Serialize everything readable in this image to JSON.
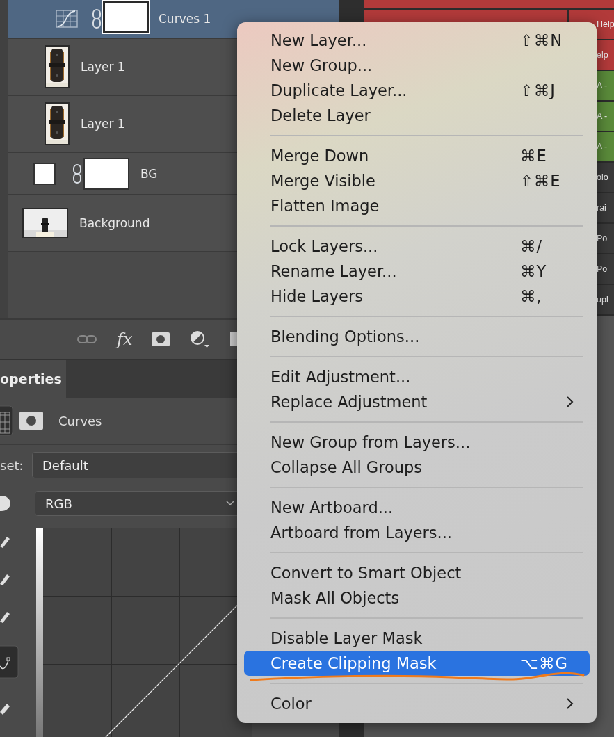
{
  "layers": [
    {
      "name": "Curves 1",
      "kind": "adjustment",
      "selected": true
    },
    {
      "name": "Layer 1",
      "selected": false
    },
    {
      "name": "Layer 1",
      "selected": false
    },
    {
      "name": "BG",
      "kind": "fill",
      "selected": false
    },
    {
      "name": "Background",
      "kind": "background",
      "selected": false
    }
  ],
  "layer_toolbar": {
    "fx": "fx"
  },
  "properties": {
    "tab": "operties",
    "type": "Curves",
    "preset_label": "set:",
    "preset": "Default",
    "channel": "RGB"
  },
  "right_table": {
    "rows": [
      {
        "col_2": "Help",
        "color": "#b23a3a"
      },
      {
        "col_2": "elp",
        "color": "#b23a3a"
      },
      {
        "col_2": "A -",
        "color": "#5a8a3a"
      },
      {
        "col_2": "A -",
        "color": "#5a8a3a"
      },
      {
        "col_2": "A -",
        "color": "#5a8a3a"
      },
      {
        "col_2": "olo",
        "color": "#3a3a3a"
      },
      {
        "col_2": "rai",
        "color": "#3a3a3a"
      },
      {
        "col_2": "Po",
        "color": "#3a3a3a"
      },
      {
        "col_2": "Po",
        "color": "#3a3a3a"
      },
      {
        "col_2": "upl",
        "color": "#3a3a3a"
      }
    ]
  },
  "context_menu": {
    "groups": [
      [
        {
          "label": "New Layer...",
          "shortcut": "⇧⌘N",
          "submenu": false,
          "selected": false
        },
        {
          "label": "New Group...",
          "submenu": false,
          "selected": false
        },
        {
          "label": "Duplicate Layer...",
          "shortcut": "⇧⌘J",
          "submenu": false,
          "selected": false
        },
        {
          "label": "Delete Layer",
          "submenu": false,
          "selected": false
        }
      ],
      [
        {
          "label": "Merge Down",
          "shortcut": "⌘E",
          "submenu": false,
          "selected": false
        },
        {
          "label": "Merge Visible",
          "shortcut": "⇧⌘E",
          "submenu": false,
          "selected": false
        },
        {
          "label": "Flatten Image",
          "submenu": false,
          "selected": false
        }
      ],
      [
        {
          "label": "Lock Layers...",
          "shortcut": "⌘/",
          "submenu": false,
          "selected": false
        },
        {
          "label": "Rename Layer...",
          "shortcut": "⌘Y",
          "submenu": false,
          "selected": false
        },
        {
          "label": "Hide Layers",
          "shortcut": "⌘,",
          "submenu": false,
          "selected": false
        }
      ],
      [
        {
          "label": "Blending Options...",
          "submenu": false,
          "selected": false
        }
      ],
      [
        {
          "label": "Edit Adjustment...",
          "submenu": false,
          "selected": false
        },
        {
          "label": "Replace Adjustment",
          "submenu": true,
          "selected": false
        }
      ],
      [
        {
          "label": "New Group from Layers...",
          "submenu": false,
          "selected": false
        },
        {
          "label": "Collapse All Groups",
          "submenu": false,
          "selected": false
        }
      ],
      [
        {
          "label": "New Artboard...",
          "submenu": false,
          "selected": false
        },
        {
          "label": "Artboard from Layers...",
          "submenu": false,
          "selected": false
        }
      ],
      [
        {
          "label": "Convert to Smart Object",
          "submenu": false,
          "selected": false
        },
        {
          "label": "Mask All Objects",
          "submenu": false,
          "selected": false
        }
      ],
      [
        {
          "label": "Disable Layer Mask",
          "submenu": false,
          "selected": false
        },
        {
          "label": "Create Clipping Mask",
          "shortcut": "⌥⌘G",
          "submenu": false,
          "selected": true
        }
      ],
      [
        {
          "label": "Color",
          "submenu": true,
          "selected": false
        }
      ]
    ]
  }
}
